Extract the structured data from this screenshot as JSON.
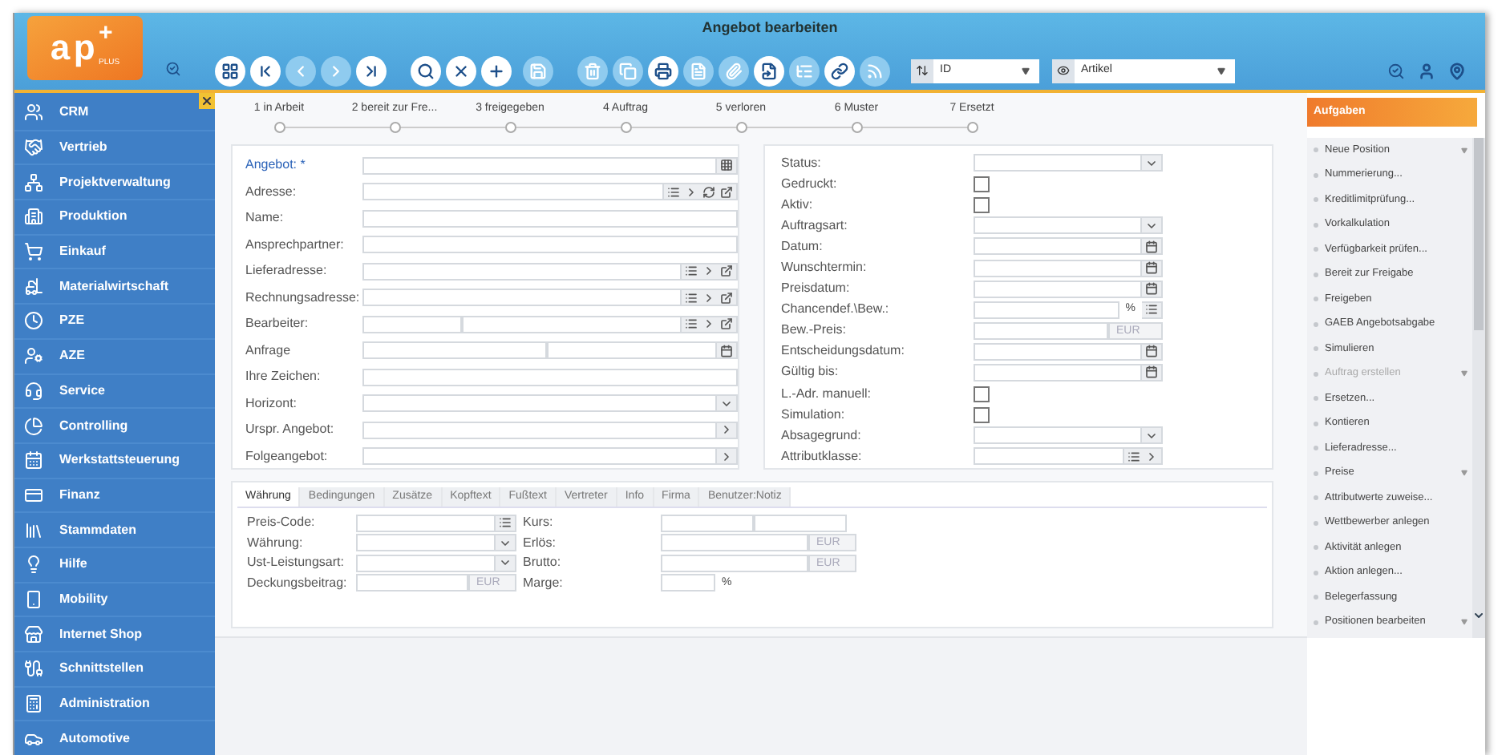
{
  "header": {
    "title": "Angebot bearbeiten",
    "logo": {
      "text": "ap",
      "mark": "+",
      "sub": "PLUS"
    },
    "toolbar": [
      {
        "kind": "grid",
        "enabled": true
      },
      {
        "kind": "first",
        "enabled": true
      },
      {
        "kind": "prev",
        "enabled": false
      },
      {
        "kind": "next",
        "enabled": false
      },
      {
        "kind": "last",
        "enabled": true
      },
      {
        "kind": "search",
        "enabled": true
      },
      {
        "kind": "close",
        "enabled": true
      },
      {
        "kind": "add",
        "enabled": true
      },
      {
        "kind": "save",
        "enabled": false
      },
      {
        "kind": "delete",
        "enabled": false
      },
      {
        "kind": "copy",
        "enabled": false
      },
      {
        "kind": "print",
        "enabled": true
      },
      {
        "kind": "document",
        "enabled": false
      },
      {
        "kind": "clip",
        "enabled": false
      },
      {
        "kind": "attach",
        "enabled": true
      },
      {
        "kind": "tree",
        "enabled": false
      },
      {
        "kind": "link",
        "enabled": true
      },
      {
        "kind": "feed",
        "enabled": false
      }
    ],
    "sort_select": {
      "value": "ID"
    },
    "view_select": {
      "value": "Artikel"
    }
  },
  "sidebar": {
    "items": [
      {
        "label": "CRM"
      },
      {
        "label": "Vertrieb"
      },
      {
        "label": "Projektverwaltung"
      },
      {
        "label": "Produktion"
      },
      {
        "label": "Einkauf"
      },
      {
        "label": "Materialwirtschaft"
      },
      {
        "label": "PZE"
      },
      {
        "label": "AZE"
      },
      {
        "label": "Service"
      },
      {
        "label": "Controlling"
      },
      {
        "label": "Werkstattsteuerung"
      },
      {
        "label": "Finanz"
      },
      {
        "label": "Stammdaten"
      },
      {
        "label": "Hilfe"
      },
      {
        "label": "Mobility"
      },
      {
        "label": "Internet Shop"
      },
      {
        "label": "Schnittstellen"
      },
      {
        "label": "Administration"
      },
      {
        "label": "Automotive"
      }
    ]
  },
  "steps": [
    {
      "label": "1 in Arbeit"
    },
    {
      "label": "2 bereit zur Fre..."
    },
    {
      "label": "3 freigegeben"
    },
    {
      "label": "4 Auftrag"
    },
    {
      "label": "5 verloren"
    },
    {
      "label": "6 Muster"
    },
    {
      "label": "7 Ersetzt"
    }
  ],
  "form": {
    "left": [
      {
        "label": "Angebot: *",
        "kind": "grid",
        "required": true
      },
      {
        "label": "Adresse:",
        "kind": "lookup-refresh",
        "required": false
      },
      {
        "label": "Name:",
        "kind": "text",
        "required": false
      },
      {
        "label": "Ansprechpartner:",
        "kind": "text",
        "required": false
      },
      {
        "label": "Lieferadresse:",
        "kind": "lookup",
        "required": false
      },
      {
        "label": "Rechnungsadresse:",
        "kind": "lookup",
        "required": false
      },
      {
        "label": "Bearbeiter:",
        "kind": "split-lookup",
        "required": false
      },
      {
        "label": "Anfrage",
        "kind": "split-date",
        "required": false
      },
      {
        "label": "Ihre Zeichen:",
        "kind": "text",
        "required": false
      },
      {
        "label": "Horizont:",
        "kind": "select",
        "required": false
      },
      {
        "label": "Urspr. Angebot:",
        "kind": "link",
        "required": false
      },
      {
        "label": "Folgeangebot:",
        "kind": "link",
        "required": false
      }
    ],
    "right": [
      {
        "label": "Status:",
        "kind": "select"
      },
      {
        "label": "Gedruckt:",
        "kind": "checkbox",
        "checked": false
      },
      {
        "label": "Aktiv:",
        "kind": "checkbox",
        "checked": false
      },
      {
        "label": "Auftragsart:",
        "kind": "select"
      },
      {
        "label": "Datum:",
        "kind": "date"
      },
      {
        "label": "Wunschtermin:",
        "kind": "date"
      },
      {
        "label": "Preisdatum:",
        "kind": "date"
      },
      {
        "label": "Chancendef.\\Bew.:",
        "kind": "percent-list",
        "unit": "%"
      },
      {
        "label": "Bew.-Preis:",
        "kind": "currency",
        "unit": "EUR"
      },
      {
        "label": "Entscheidungsdatum:",
        "kind": "date"
      },
      {
        "label": "Gültig bis:",
        "kind": "date"
      },
      {
        "label": "L.-Adr. manuell:",
        "kind": "checkbox",
        "checked": false
      },
      {
        "label": "Simulation:",
        "kind": "checkbox",
        "checked": false
      },
      {
        "label": "Absagegrund:",
        "kind": "select"
      },
      {
        "label": "Attributklasse:",
        "kind": "list-link"
      }
    ]
  },
  "detail_tabs": [
    {
      "label": "Währung",
      "selected": true
    },
    {
      "label": "Bedingungen",
      "selected": false
    },
    {
      "label": "Zusätze",
      "selected": false
    },
    {
      "label": "Kopftext",
      "selected": false
    },
    {
      "label": "Fußtext",
      "selected": false
    },
    {
      "label": "Vertreter",
      "selected": false
    },
    {
      "label": "Info",
      "selected": false
    },
    {
      "label": "Firma",
      "selected": false
    },
    {
      "label": "Benutzer:Notiz",
      "selected": false
    }
  ],
  "detail": {
    "left": [
      {
        "label": "Preis-Code:",
        "kind": "list"
      },
      {
        "label": "Währung:",
        "kind": "select"
      },
      {
        "label": "Ust-Leistungsart:",
        "kind": "select"
      },
      {
        "label": "Deckungsbeitrag:",
        "kind": "currency",
        "unit": "EUR"
      }
    ],
    "right": [
      {
        "label": "Kurs:",
        "kind": "split"
      },
      {
        "label": "Erlös:",
        "kind": "currency",
        "unit": "EUR"
      },
      {
        "label": "Brutto:",
        "kind": "currency",
        "unit": "EUR"
      },
      {
        "label": "Marge:",
        "kind": "percent",
        "unit": "%"
      }
    ]
  },
  "tasks": {
    "title": "Aufgaben",
    "items": [
      {
        "label": "Neue Position",
        "disabled": false,
        "submenu": true
      },
      {
        "label": "Nummerierung...",
        "disabled": false,
        "submenu": false
      },
      {
        "label": "Kreditlimitprüfung...",
        "disabled": false,
        "submenu": false
      },
      {
        "label": "Vorkalkulation",
        "disabled": false,
        "submenu": false
      },
      {
        "label": "Verfügbarkeit prüfen...",
        "disabled": false,
        "submenu": false
      },
      {
        "label": "Bereit zur Freigabe",
        "disabled": false,
        "submenu": false
      },
      {
        "label": "Freigeben",
        "disabled": false,
        "submenu": false
      },
      {
        "label": "GAEB Angebotsabgabe",
        "disabled": false,
        "submenu": false
      },
      {
        "label": "Simulieren",
        "disabled": false,
        "submenu": false
      },
      {
        "label": "Auftrag erstellen",
        "disabled": true,
        "submenu": true
      },
      {
        "label": "Ersetzen...",
        "disabled": false,
        "submenu": false
      },
      {
        "label": "Kontieren",
        "disabled": false,
        "submenu": false
      },
      {
        "label": "Lieferadresse...",
        "disabled": false,
        "submenu": false
      },
      {
        "label": "Preise",
        "disabled": false,
        "submenu": true
      },
      {
        "label": "Attributwerte zuweise...",
        "disabled": false,
        "submenu": false
      },
      {
        "label": "Wettbewerber anlegen",
        "disabled": false,
        "submenu": false
      },
      {
        "label": "Aktivität anlegen",
        "disabled": false,
        "submenu": false
      },
      {
        "label": "Aktion anlegen...",
        "disabled": false,
        "submenu": false
      },
      {
        "label": "Belegerfassung",
        "disabled": false,
        "submenu": false
      },
      {
        "label": "Positionen bearbeiten",
        "disabled": false,
        "submenu": true
      }
    ]
  }
}
